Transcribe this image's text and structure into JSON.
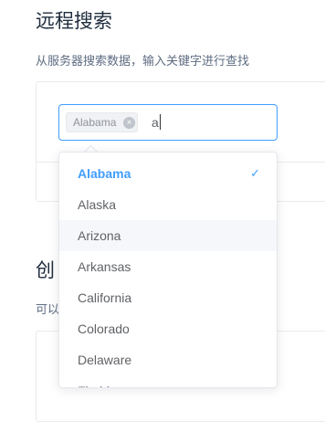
{
  "section1": {
    "title": "远程搜索",
    "description": "从服务器搜索数据，输入关键字进行查找"
  },
  "select": {
    "tags": [
      {
        "label": "Alabama",
        "close_icon": "close-circle-icon"
      }
    ],
    "query": "a"
  },
  "dropdown": {
    "options": [
      {
        "label": "Alabama",
        "selected": true,
        "hover": false
      },
      {
        "label": "Alaska",
        "selected": false,
        "hover": false
      },
      {
        "label": "Arizona",
        "selected": false,
        "hover": true
      },
      {
        "label": "Arkansas",
        "selected": false,
        "hover": false
      },
      {
        "label": "California",
        "selected": false,
        "hover": false
      },
      {
        "label": "Colorado",
        "selected": false,
        "hover": false
      },
      {
        "label": "Delaware",
        "selected": false,
        "hover": false
      },
      {
        "label": "Florida",
        "selected": false,
        "hover": false
      }
    ],
    "check_icon": "check-icon"
  },
  "section2": {
    "title_partial": "创",
    "description_partial": "可以"
  },
  "colors": {
    "accent": "#409eff",
    "hover_bg": "#f5f7fa",
    "text": "#606266"
  }
}
